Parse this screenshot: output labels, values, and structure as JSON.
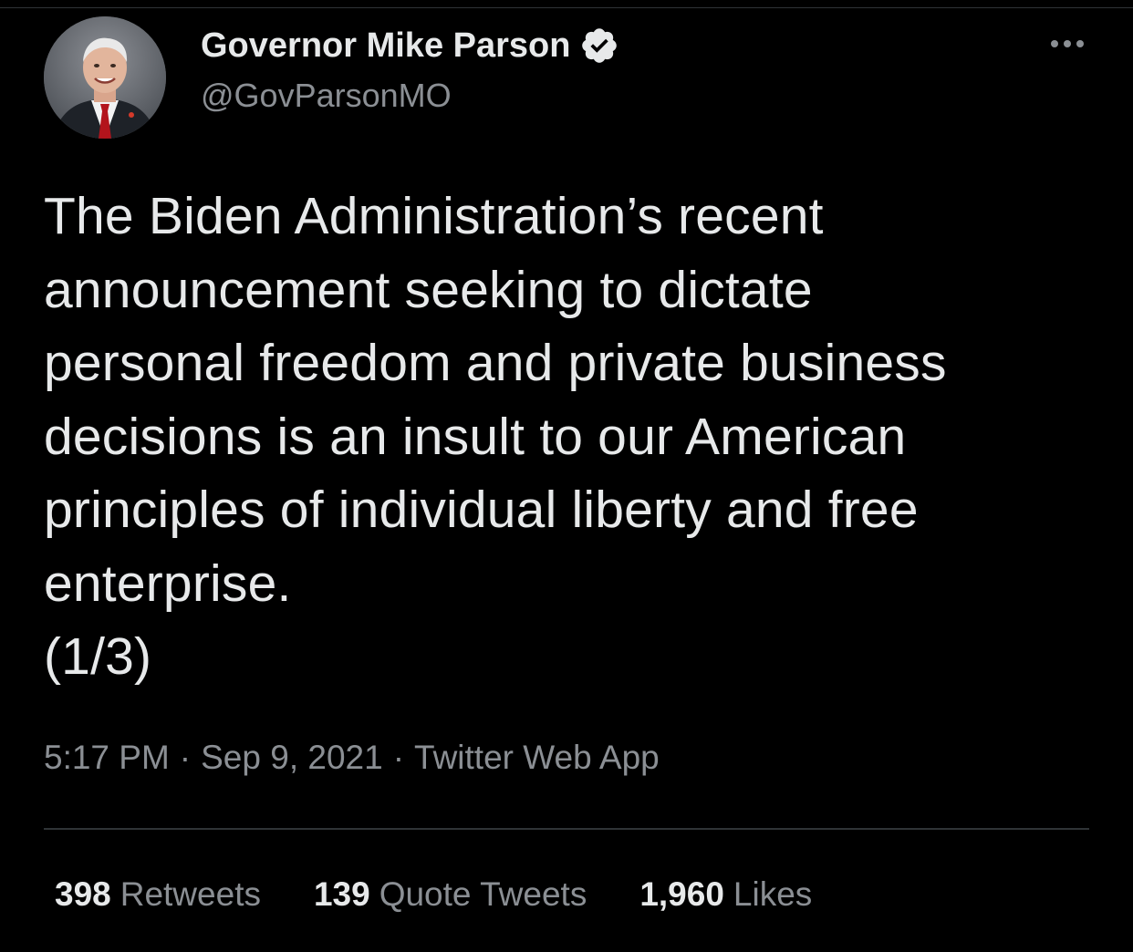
{
  "author": {
    "display_name": "Governor Mike Parson",
    "handle": "@GovParsonMO",
    "verified": true,
    "avatar_icon": "profile-photo-icon"
  },
  "tweet": {
    "text": "The Biden Administration’s recent\nannouncement seeking to dictate\npersonal freedom and private business\ndecisions is an insult to our American\nprinciples of individual liberty and free\nenterprise.\n(1/3)"
  },
  "meta": {
    "time": "5:17 PM",
    "separator": "·",
    "date": "Sep 9, 2021",
    "source": "Twitter Web App"
  },
  "stats": {
    "retweets": {
      "count": "398",
      "label": "Retweets"
    },
    "quotes": {
      "count": "139",
      "label": "Quote Tweets"
    },
    "likes": {
      "count": "1,960",
      "label": "Likes"
    }
  },
  "colors": {
    "background": "#000000",
    "primary_text": "#e7e9ea",
    "secondary_text": "#8b8f94",
    "divider": "#2f3336"
  }
}
